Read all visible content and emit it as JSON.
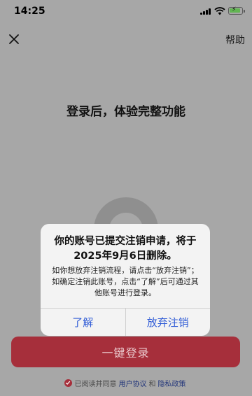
{
  "status_bar": {
    "time": "14:25"
  },
  "header": {
    "help_label": "帮助"
  },
  "main": {
    "headline": "登录后，体验完整功能",
    "login_button_label": "一键登录"
  },
  "agreement": {
    "prefix": "已阅读并同意",
    "user_agreement": "用户协议",
    "and": "和",
    "privacy_policy": "隐私政策"
  },
  "dialog": {
    "title": "你的账号已提交注销申请，将于2025年9月6日删除。",
    "message": "如你想放弃注销流程，请点击“放弃注销”；如确定注销此账号，点击“了解”后可通过其他账号进行登录。",
    "button_ok": "了解",
    "button_cancel_deletion": "放弃注销"
  },
  "colors": {
    "overlay_background": "#a7a7a7",
    "primary_button": "#a62f3b",
    "dialog_action": "#2f5bd6",
    "link": "#22357a"
  }
}
